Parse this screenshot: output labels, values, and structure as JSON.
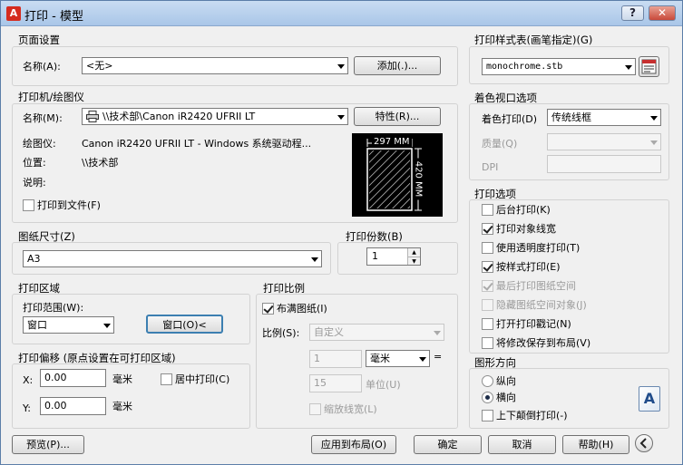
{
  "title": "打印 - 模型",
  "window_controls": {
    "help": "?",
    "close": "✕"
  },
  "page_setup": {
    "group": "页面设置",
    "name_label": "名称(A):",
    "name_value": "<无>",
    "add_button": "添加(.)..."
  },
  "printer": {
    "group": "打印机/绘图仪",
    "name_label": "名称(M):",
    "name_value": "\\\\技术部\\Canon iR2420 UFRII LT",
    "properties_button": "特性(R)...",
    "plotter_label": "绘图仪:",
    "plotter_value": "Canon iR2420 UFRII LT - Windows 系统驱动程...",
    "location_label": "位置:",
    "location_value": "\\\\技术部",
    "description_label": "说明:",
    "print_to_file": "打印到文件(F)",
    "print_to_file_checked": false,
    "preview_width": "297 MM",
    "preview_height": "420 MM"
  },
  "paper_size": {
    "group": "图纸尺寸(Z)",
    "value": "A3"
  },
  "copies": {
    "group": "打印份数(B)",
    "value": "1"
  },
  "plot_area": {
    "group": "打印区域",
    "range_label": "打印范围(W):",
    "range_value": "窗口",
    "window_button": "窗口(O)<"
  },
  "plot_offset": {
    "group": "打印偏移 (原点设置在可打印区域)",
    "x_label": "X:",
    "x_value": "0.00",
    "x_unit": "毫米",
    "y_label": "Y:",
    "y_value": "0.00",
    "y_unit": "毫米",
    "center": "居中打印(C)",
    "center_checked": false
  },
  "plot_scale": {
    "group": "打印比例",
    "fit": "布满图纸(I)",
    "fit_checked": true,
    "scale_label": "比例(S):",
    "scale_value": "自定义",
    "value1": "1",
    "unit1": "毫米",
    "equals": "=",
    "value2": "15",
    "unit2_label": "单位(U)",
    "lineweights": "缩放线宽(L)",
    "lineweights_checked": false
  },
  "plot_style": {
    "group": "打印样式表(画笔指定)(G)",
    "value": "monochrome.stb"
  },
  "shaded": {
    "group": "着色视口选项",
    "shade_label": "着色打印(D)",
    "shade_value": "传统线框",
    "quality_label": "质量(Q)",
    "dpi_label": "DPI"
  },
  "plot_options": {
    "group": "打印选项",
    "items": [
      {
        "label": "后台打印(K)",
        "checked": false,
        "disabled": false
      },
      {
        "label": "打印对象线宽",
        "checked": true,
        "disabled": false
      },
      {
        "label": "使用透明度打印(T)",
        "checked": false,
        "disabled": false
      },
      {
        "label": "按样式打印(E)",
        "checked": true,
        "disabled": false
      },
      {
        "label": "最后打印图纸空间",
        "checked": true,
        "disabled": true
      },
      {
        "label": "隐藏图纸空间对象(J)",
        "checked": false,
        "disabled": true
      },
      {
        "label": "打开打印戳记(N)",
        "checked": false,
        "disabled": false
      },
      {
        "label": "将修改保存到布局(V)",
        "checked": false,
        "disabled": false
      }
    ]
  },
  "orientation": {
    "group": "图形方向",
    "portrait": "纵向",
    "landscape": "横向",
    "selected": "landscape",
    "upside_down": "上下颠倒打印(-)",
    "upside_down_checked": false,
    "icon_letter": "A"
  },
  "footer": {
    "preview": "预览(P)...",
    "apply": "应用到布局(O)",
    "ok": "确定",
    "cancel": "取消",
    "help": "帮助(H)"
  }
}
